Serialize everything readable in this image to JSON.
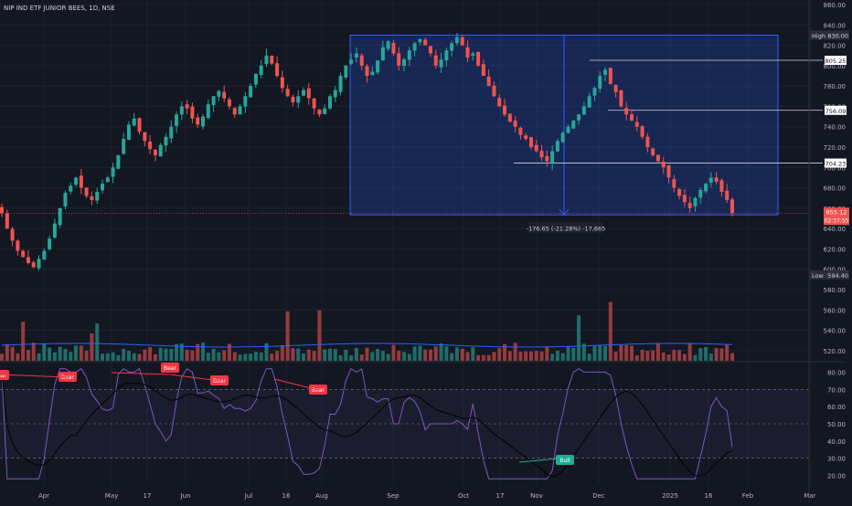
{
  "header": {
    "symbol_line": "NIP IND ETF JUNIOR BEES, 1D, NSE"
  },
  "colors": {
    "background": "#131722",
    "up": "#26a69a",
    "down": "#ef5350",
    "grid": "#1e222d",
    "axis_text": "#b2b5be",
    "range_box": "#2962ff",
    "rsi_line": "#7e57c2",
    "rsi_ma": "#000000",
    "bear_label": "#f23645",
    "bull_label": "#22ab94"
  },
  "chart_data": {
    "type": "candlestick",
    "price_axis": {
      "ticks": [
        "860.00",
        "840.00",
        "820.00",
        "800.00",
        "780.00",
        "760.00",
        "740.00",
        "720.00",
        "700.00",
        "680.00",
        "660.00",
        "640.00",
        "620.00",
        "600.00",
        "580.00",
        "560.00",
        "540.00",
        "520.00"
      ],
      "range": [
        510,
        860
      ]
    },
    "time_axis": {
      "ticks": [
        "Apr",
        "May",
        "17",
        "Jun",
        "Jul",
        "16",
        "Aug",
        "Sep",
        "Oct",
        "17",
        "Nov",
        "Dec",
        "2025",
        "16",
        "Feb",
        "Mar"
      ]
    },
    "price_labels": {
      "high_label": "High",
      "high_value": "830.00",
      "low_label": "Low",
      "low_value": "594.40",
      "last_price": "655.12",
      "countdown": "02:37:55",
      "levels": [
        "805.25",
        "756.09",
        "704.23"
      ]
    },
    "measure_box": {
      "label": "-176.65 (-21.28%) -17,665",
      "top_price": 830.0,
      "bottom_price": 653.35
    },
    "rsi": {
      "ticks": [
        "80.00",
        "70.00",
        "60.00",
        "50.00",
        "40.00",
        "30.00",
        "20.00"
      ],
      "upper_band": 70,
      "middle": 50,
      "lower_band": 30,
      "divergence_labels": [
        "Bear",
        "Bear",
        "Bear",
        "Bear",
        "Bear",
        "Bull"
      ]
    },
    "series": [
      {
        "name": "Price",
        "role": "close_path",
        "closes": [
          655,
          640,
          628,
          618,
          612,
          606,
          602,
          610,
          618,
          630,
          645,
          660,
          675,
          682,
          690,
          680,
          672,
          668,
          676,
          684,
          690,
          700,
          712,
          728,
          742,
          748,
          735,
          726,
          718,
          712,
          722,
          730,
          740,
          752,
          760,
          758,
          748,
          742,
          750,
          762,
          770,
          775,
          768,
          760,
          752,
          760,
          770,
          780,
          792,
          800,
          810,
          802,
          790,
          778,
          770,
          764,
          770,
          776,
          768,
          758,
          752,
          758,
          770,
          776,
          790,
          800,
          806,
          812,
          800,
          790,
          794,
          805,
          818,
          824,
          812,
          800,
          806,
          815,
          822,
          826,
          820,
          812,
          800,
          806,
          815,
          822,
          828,
          820,
          808,
          812,
          800,
          790,
          780,
          770,
          760,
          752,
          745,
          740,
          732,
          728,
          720,
          716,
          710,
          706,
          716,
          726,
          734,
          740,
          746,
          752,
          760,
          770,
          778,
          790,
          796,
          782,
          774,
          760,
          752,
          746,
          740,
          730,
          720,
          712,
          706,
          700,
          690,
          680,
          672,
          666,
          660,
          670,
          678,
          684,
          690,
          686,
          676,
          668,
          655
        ]
      }
    ]
  }
}
